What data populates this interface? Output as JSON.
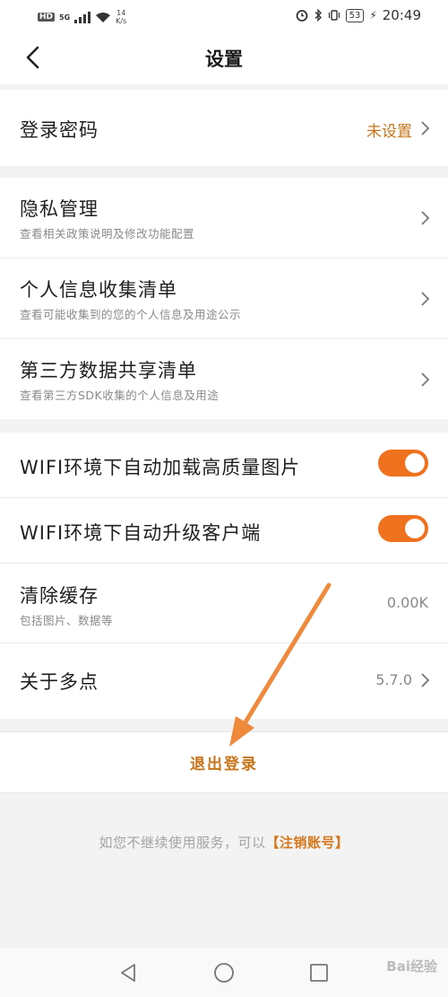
{
  "status_bar": {
    "hd": "HD",
    "network": "5G",
    "speed_value": "14",
    "speed_unit": "K/s",
    "battery": "53",
    "time": "20:49"
  },
  "header": {
    "title": "设置"
  },
  "password": {
    "label": "登录密码",
    "value": "未设置"
  },
  "privacy": [
    {
      "title": "隐私管理",
      "subtitle": "查看相关政策说明及修改功能配置"
    },
    {
      "title": "个人信息收集清单",
      "subtitle": "查看可能收集到的您的个人信息及用途公示"
    },
    {
      "title": "第三方数据共享清单",
      "subtitle": "查看第三方SDK收集的个人信息及用途"
    }
  ],
  "settings": {
    "wifi_images": {
      "label": "WIFI环境下自动加载高质量图片",
      "enabled": true
    },
    "wifi_upgrade": {
      "label": "WIFI环境下自动升级客户端",
      "enabled": true
    },
    "cache": {
      "title": "清除缓存",
      "subtitle": "包括图片、数据等",
      "value": "0.00K"
    },
    "about": {
      "title": "关于多点",
      "value": "5.7.0"
    }
  },
  "logout": {
    "label": "退出登录"
  },
  "footer": {
    "text": "如您不继续使用服务，可以",
    "link": "【注销账号】"
  },
  "watermark": "Bai经验",
  "colors": {
    "accent": "#f0721f",
    "accent_text": "#c8741a"
  }
}
